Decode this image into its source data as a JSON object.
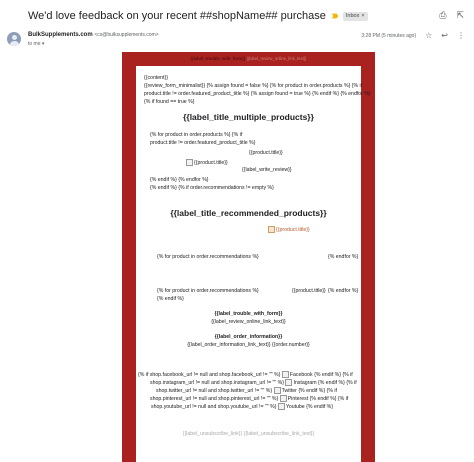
{
  "header": {
    "subject": "We'd love feedback on your recent ##shopName## purchase",
    "label_badge": "Inbox",
    "label_badge_close": "×"
  },
  "top_icons": {
    "print": "⎙",
    "open_new": "⇱"
  },
  "sender": {
    "name": "BulkSupplements.com",
    "email": "<cs@bulksupplements.com>",
    "to": "to me",
    "to_caret": "▾",
    "date": "3:28 PM (5 minutes ago)",
    "icons": {
      "star": "☆",
      "reply": "↩",
      "more": "⋮"
    }
  },
  "email_body": {
    "header_text": {
      "left": "{{label_trouble_with_form}}",
      "right": "{{label_review_online_link_text}}"
    },
    "lines": {
      "l1": "{{content}}",
      "l2": "{{review_form_minimalist}} {% assign found = false %} {% for product in order.products %} {% if",
      "l3": "product.title != order.featured_product_title %} {% assign found = true %} {% endif %} {% endfor %}",
      "l4": "{% if found == true %}",
      "heading1": "{{label_title_multiple_products}}",
      "l5": "{% for product in order.products %} {% if",
      "l6": "product.title != order.featured_product_title %}",
      "product_title_1": "{{product.title}}",
      "img_alt_1": "{{product.title}}",
      "write_review": "{{label_write_review}}",
      "l7": "{% endif %} {% endfor %}",
      "l8": "{% endif %} {% if order.recommendations != empty %}",
      "heading2": "{{label_title_recommended_products}}",
      "img_alt_2": "{{product.title}}",
      "for_recs_1": "{% for product in order.recommendations %}",
      "endfor_1": "{% endfor %}",
      "for_recs_2": "{% for product in order.recommendations %}",
      "product_title_2": "{{product.title}}",
      "endfor_2": "{% endfor %}",
      "endif_1": "{% endif %}",
      "trouble": "{{label_trouble_with_form}}",
      "review_link": "{{label_review_online_link_text}}",
      "order_info": "{{label_order_information}}",
      "order_link": "{{label_order_information_link_text}} {{order.number}}",
      "social_1a": "{% if shop.facebook_url != null and shop.facebook_url != \"\" %}",
      "social_1b": "Facebook",
      "social_1c": "{% endif %} {% if",
      "social_2a": "shop.instagram_url != null and shop.instagram_url != \"\" %}",
      "social_2b": "Instagram",
      "social_2c": "{% endif %} {% if",
      "social_3a": "shop.twitter_url != null and shop.twitter_url != \"\" %}",
      "social_3b": "Twitter",
      "social_3c": "{% endif %} {% if",
      "social_4a": "shop.pinterest_url != null and shop.pinterest_url != \"\" %}",
      "social_4b": "Pinterest",
      "social_4c": "{% endif %} {% if",
      "social_5a": "shop.youtube_url != null and shop.youtube_url != \"\" %}",
      "social_5b": "Youtube",
      "social_5c": "{% endif %}",
      "footer_left": "{{label_unsubscribe_link}}",
      "footer_right": "{{label_unsubscribe_link_text}}"
    }
  },
  "colors": {
    "frame": "#a9221f",
    "background": "#ffffff",
    "orange_link": "#b55a2a"
  }
}
